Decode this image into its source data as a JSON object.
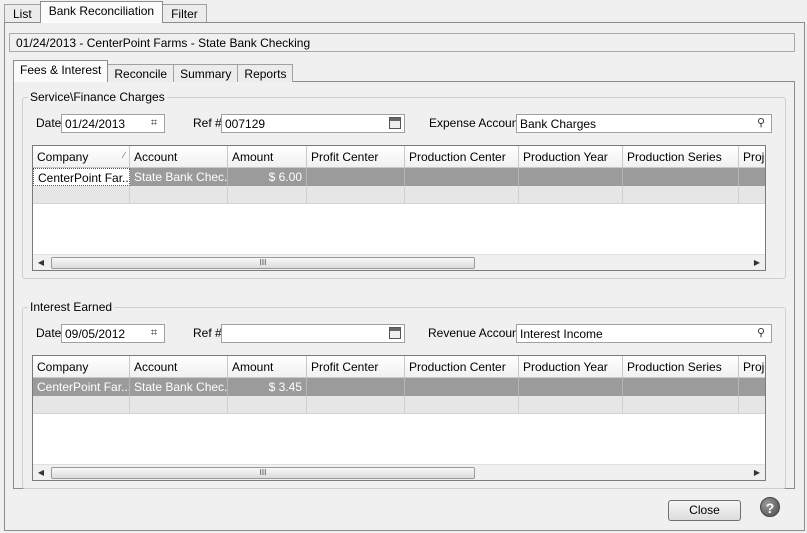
{
  "top_tabs": [
    "List",
    "Bank Reconciliation",
    "Filter"
  ],
  "header": "01/24/2013 - CenterPoint Farms - State Bank Checking",
  "sub_tabs": [
    "Fees & Interest",
    "Reconcile",
    "Summary",
    "Reports"
  ],
  "columns": [
    "Company",
    "Account",
    "Amount",
    "Profit Center",
    "Production Center",
    "Production Year",
    "Production Series",
    "Proje"
  ],
  "service": {
    "title": "Service\\Finance Charges",
    "date_label": "Date",
    "date": "01/24/2013",
    "ref_label": "Ref #",
    "ref": "007129",
    "account_label": "Expense Account",
    "account": "Bank Charges",
    "row": {
      "company": "CenterPoint Far...",
      "account": "State Bank Chec...",
      "amount": "$ 6.00"
    }
  },
  "interest": {
    "title": "Interest Earned",
    "date_label": "Date",
    "date": "09/05/2012",
    "ref_label": "Ref #",
    "ref": "",
    "account_label": "Revenue Account",
    "account": "Interest Income",
    "row": {
      "company": "CenterPoint Far...",
      "account": "State Bank Chec...",
      "amount": "$ 3.45"
    }
  },
  "close_label": "Close",
  "help_glyph": "?",
  "scroll_thumb_glyph": "III"
}
